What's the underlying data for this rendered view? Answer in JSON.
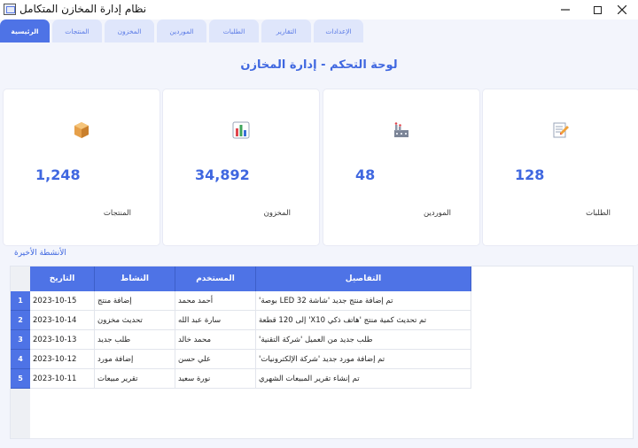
{
  "window": {
    "title": "نظام إدارة المخازن المتكامل"
  },
  "tabs": [
    {
      "label": "الرئيسية",
      "active": true
    },
    {
      "label": "المنتجات",
      "active": false
    },
    {
      "label": "المخزون",
      "active": false
    },
    {
      "label": "الموردين",
      "active": false
    },
    {
      "label": "الطلبات",
      "active": false
    },
    {
      "label": "التقارير",
      "active": false
    },
    {
      "label": "الإعدادات",
      "active": false
    }
  ],
  "page": {
    "title": "لوحة التحكم - إدارة المخازن"
  },
  "cards": [
    {
      "icon": "package-icon",
      "value": "1,248",
      "label": "المنتجات"
    },
    {
      "icon": "bar-chart-icon",
      "value": "34,892",
      "label": "المخزون"
    },
    {
      "icon": "factory-icon",
      "value": "48",
      "label": "الموردين"
    },
    {
      "icon": "memo-icon",
      "value": "128",
      "label": "الطلبات"
    }
  ],
  "activity": {
    "section_label": "الأنشطة الأخيرة",
    "headers": {
      "date": "التاريخ",
      "activity": "النشاط",
      "user": "المستخدم",
      "details": "التفاصيل"
    },
    "rows": [
      {
        "num": "1",
        "date": "2023-10-15",
        "activity": "إضافة منتج",
        "user": "أحمد محمد",
        "details": "تم إضافة منتج جديد 'شاشة LED 32 بوصة'"
      },
      {
        "num": "2",
        "date": "2023-10-14",
        "activity": "تحديث مخزون",
        "user": "سارة عبد الله",
        "details": "تم تحديث كمية منتج 'هاتف ذكي X10' إلى 120 قطعة"
      },
      {
        "num": "3",
        "date": "2023-10-13",
        "activity": "طلب جديد",
        "user": "محمد خالد",
        "details": "طلب جديد من العميل 'شركة التقنية'"
      },
      {
        "num": "4",
        "date": "2023-10-12",
        "activity": "إضافة مورد",
        "user": "علي حسن",
        "details": "تم إضافة مورد جديد 'شركة الإلكترونيات'"
      },
      {
        "num": "5",
        "date": "2023-10-11",
        "activity": "تقرير مبيعات",
        "user": "نورة سعيد",
        "details": "تم إنشاء تقرير المبيعات الشهري"
      }
    ]
  },
  "colors": {
    "accent": "#4e73e6",
    "tab_inactive": "#dfe6fb",
    "background": "#f3f5fc"
  }
}
